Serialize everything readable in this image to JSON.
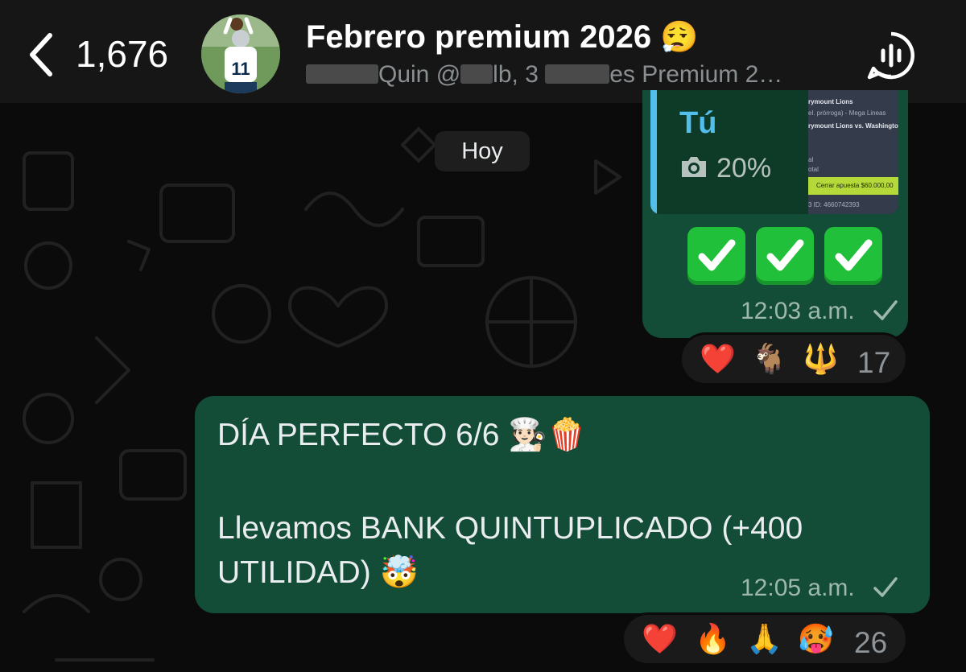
{
  "header": {
    "unread_count": "1,676",
    "group_title": "Febrero premium 2026",
    "title_emoji": "😮‍💨",
    "subtitle_visible_1": "Quin @",
    "subtitle_visible_2": "lb, 3 ",
    "subtitle_visible_3": "es Premium 2…"
  },
  "date_chip": "Hoy",
  "messages": [
    {
      "quoted": {
        "author": "Tú",
        "caption": "20%",
        "thumbnail_lines": [
          "rymount Lions",
          "el. prórroga) - Mega Lineas",
          "rymount Lions vs. Washington St Cougars",
          "al",
          "otal",
          "Cerrar apuesta $60.000,00",
          "3  ID: 4660742393"
        ]
      },
      "checks": [
        "✅",
        "✅",
        "✅"
      ],
      "time": "12:03 a.m.",
      "reactions": {
        "emojis": [
          "❤️",
          "🐐",
          "🔱"
        ],
        "count": "17"
      }
    },
    {
      "lines": [
        "DÍA PERFECTO 6/6 🧑🏻‍🍳🍿",
        "Llevamos BANK QUINTUPLICADO (+400",
        "UTILIDAD) 🤯"
      ],
      "time": "12:05 a.m.",
      "reactions": {
        "emojis": [
          "❤️",
          "🔥",
          "🙏",
          "🥵"
        ],
        "count": "26"
      }
    }
  ],
  "colors": {
    "bubble_out": "#144d37",
    "quote_accent": "#53bdeb",
    "background": "#0b0b0b",
    "header": "#161616"
  }
}
